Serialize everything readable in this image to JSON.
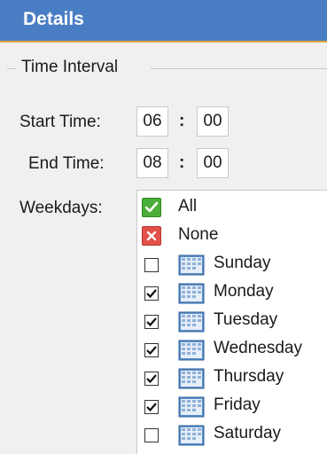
{
  "header": {
    "title": "Details"
  },
  "time_interval": {
    "legend": "Time Interval",
    "start_label": "Start Time:",
    "start_hour": "06",
    "start_minute": "00",
    "end_label": "End Time:",
    "end_hour": "08",
    "end_minute": "00",
    "separator": ":"
  },
  "weekdays": {
    "label": "Weekdays:",
    "all_label": "All",
    "none_label": "None",
    "days": [
      {
        "name": "Sunday",
        "checked": false
      },
      {
        "name": "Monday",
        "checked": true
      },
      {
        "name": "Tuesday",
        "checked": true
      },
      {
        "name": "Wednesday",
        "checked": true
      },
      {
        "name": "Thursday",
        "checked": true
      },
      {
        "name": "Friday",
        "checked": true
      },
      {
        "name": "Saturday",
        "checked": false
      }
    ]
  },
  "colors": {
    "header_bg": "#4a7ec4",
    "header_accent": "#e8a640",
    "all_icon": "#4cae3a",
    "none_icon": "#e2514a"
  }
}
